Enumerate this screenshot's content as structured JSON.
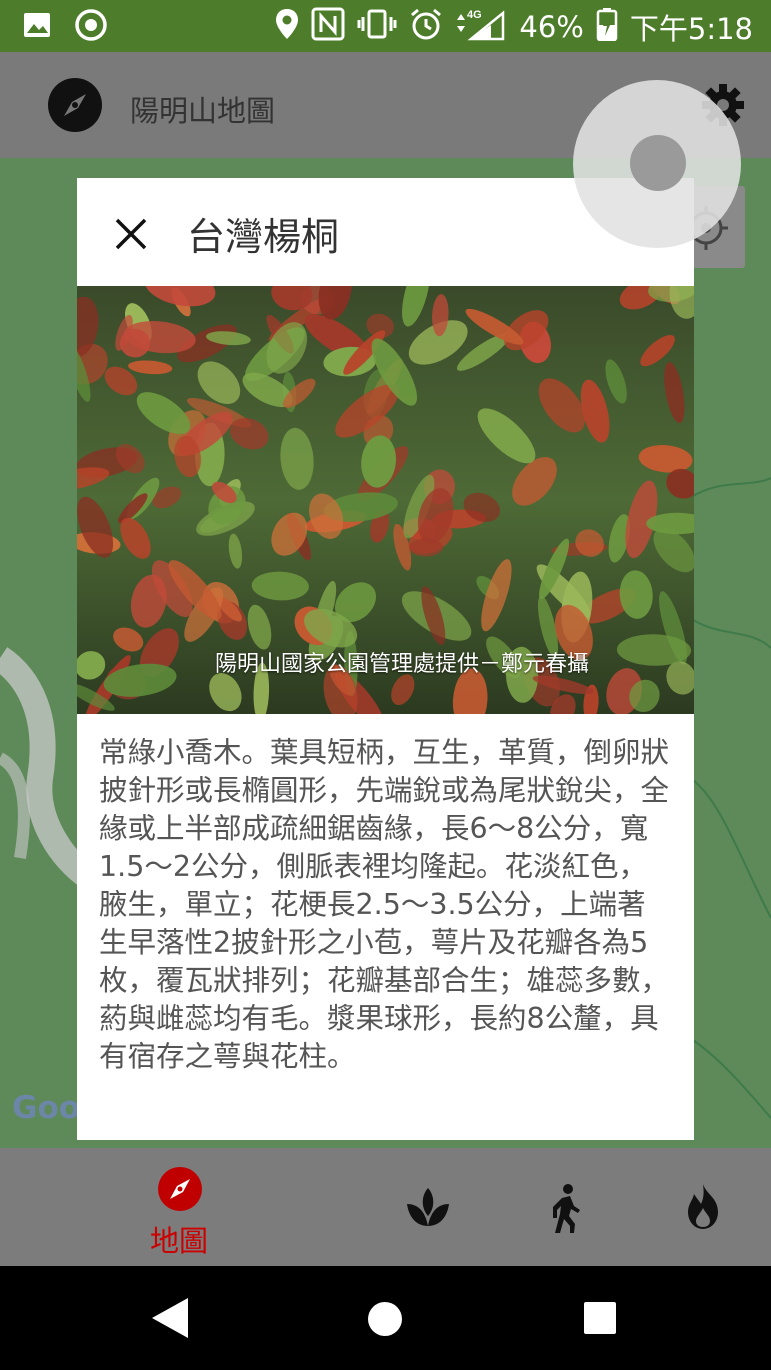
{
  "status_bar": {
    "icons_left": [
      "image-icon",
      "record-icon"
    ],
    "icons_right": [
      "location-icon",
      "nfc-icon",
      "vibrate-icon",
      "alarm-icon",
      "signal-4g-icon"
    ],
    "network": "4G",
    "battery": "46%",
    "time": "下午5:18"
  },
  "app_bar": {
    "title": "陽明山地圖",
    "logo_icon": "compass-icon",
    "settings_icon": "gear-icon"
  },
  "map": {
    "attribution": "Goo",
    "locate_icon": "crosshair-icon"
  },
  "dialog": {
    "title": "台灣楊桐",
    "close_icon": "close-icon",
    "photo_caption": "陽明山國家公園管理處提供－鄭元春攝",
    "description": "常綠小喬木。葉具短柄，互生，革質，倒卵狀披針形或長橢圓形，先端銳或為尾狀銳尖，全緣或上半部成疏細鋸齒緣，長6～8公分，寬1.5～2公分，側脈表裡均隆起。花淡紅色，腋生，單立；花梗長2.5～3.5公分，上端著生早落性2披針形之小苞，萼片及花瓣各為5枚，覆瓦狀排列；花瓣基部合生；雄蕊多數，葯與雌蕊均有毛。漿果球形，長約8公釐，具有宿存之萼與花柱。"
  },
  "bottom_nav": {
    "items": [
      {
        "label": "地圖",
        "icon": "compass-icon",
        "active": true
      },
      {
        "label": "",
        "icon": "leaf-icon",
        "active": false
      },
      {
        "label": "",
        "icon": "walking-icon",
        "active": false
      },
      {
        "label": "",
        "icon": "flame-icon",
        "active": false
      }
    ],
    "active_color": "#c00000"
  },
  "system_nav": {
    "buttons": [
      "back-icon",
      "home-icon",
      "recents-icon"
    ]
  },
  "colors": {
    "status_bar": "#4d7d2a",
    "app_bar_dim": "#7a7a7a",
    "map": "#5e8a5a",
    "dialog_bg": "#ffffff"
  }
}
